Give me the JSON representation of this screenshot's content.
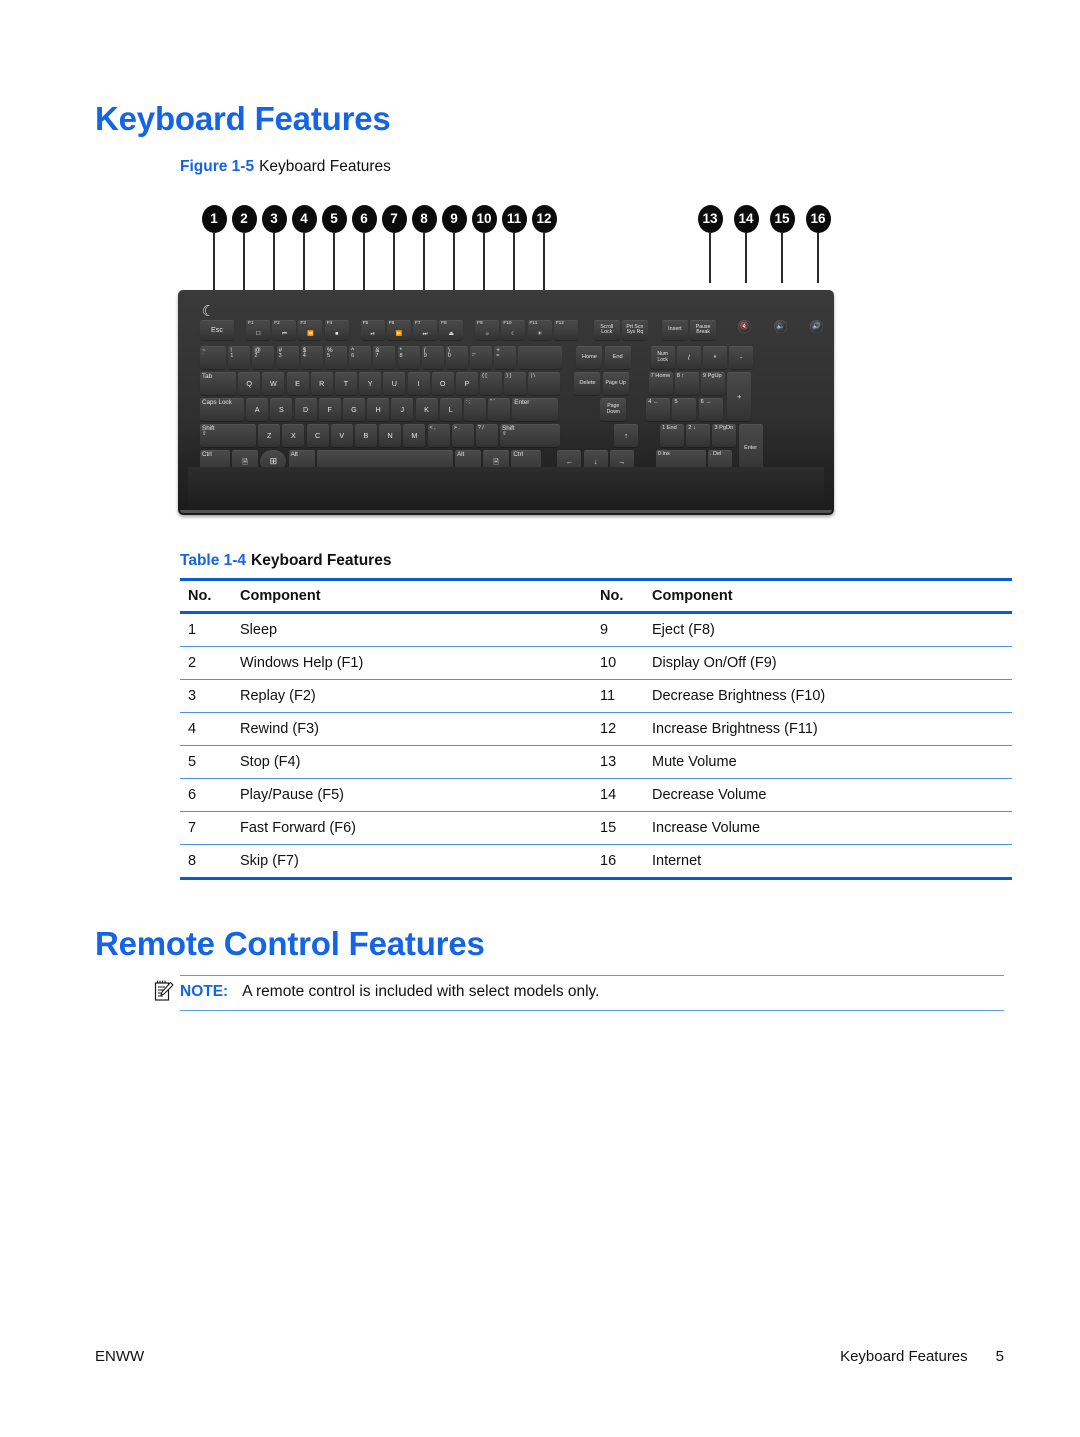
{
  "document": {
    "section_heading": "Keyboard Features",
    "figure": {
      "label": "Figure 1-5",
      "title": "Keyboard Features",
      "callouts": [
        "1",
        "2",
        "3",
        "4",
        "5",
        "6",
        "7",
        "8",
        "9",
        "10",
        "11",
        "12",
        "13",
        "14",
        "15",
        "16"
      ],
      "keyboard": {
        "indicator": "sleep-moon",
        "function_row": [
          "Esc",
          "F1",
          "F2",
          "F3",
          "F4",
          "F5",
          "F6",
          "F7",
          "F8",
          "F9",
          "F10",
          "F11",
          "F12",
          "Scroll Lock",
          "Prt Scn Sys Rq",
          "Insert",
          "Pause Break"
        ],
        "media_buttons": [
          "Mute Volume",
          "Decrease Volume",
          "Increase Volume",
          "Internet"
        ],
        "number_row": [
          {
            "a": "~",
            "b": "`"
          },
          {
            "a": "!",
            "b": "1"
          },
          {
            "a": "@",
            "b": "2"
          },
          {
            "a": "#",
            "b": "3"
          },
          {
            "a": "$",
            "b": "4"
          },
          {
            "a": "%",
            "b": "5"
          },
          {
            "a": "^",
            "b": "6"
          },
          {
            "a": "&",
            "b": "7"
          },
          {
            "a": "*",
            "b": "8"
          },
          {
            "a": "(",
            "b": "9"
          },
          {
            "a": ")",
            "b": "0"
          },
          {
            "a": "_",
            "b": "-"
          },
          {
            "a": "+",
            "b": "="
          },
          {
            "a": "",
            "b": "Backspace"
          }
        ],
        "tab_row": [
          "Tab",
          "Q",
          "W",
          "E",
          "R",
          "T",
          "Y",
          "U",
          "I",
          "O",
          "P",
          "{ [",
          "} ]",
          "| \\"
        ],
        "caps_row": [
          "Caps Lock",
          "A",
          "S",
          "D",
          "F",
          "G",
          "H",
          "J",
          "K",
          "L",
          ": ;",
          "\" '",
          "Enter"
        ],
        "shift_row": [
          "Shift",
          "Z",
          "X",
          "C",
          "V",
          "B",
          "N",
          "M",
          "< ,",
          "> .",
          "? /",
          "Shift"
        ],
        "ctrl_row": [
          "Ctrl",
          "menu-icon",
          "windows-icon",
          "Alt",
          "Space",
          "Alt",
          "menu-icon",
          "Ctrl"
        ],
        "nav_cluster": [
          "Home",
          "End",
          "Delete",
          "Page Up",
          "Page Down"
        ],
        "arrows": [
          "↑",
          "←",
          "↓",
          "→"
        ],
        "numpad": [
          "Num Lock",
          "/",
          "*",
          "-",
          "7 Home",
          "8 ↑",
          "9 PgUp",
          "+",
          "4 ←",
          "5",
          "6 →",
          "1 End",
          "2 ↓",
          "3 PgDn",
          "Enter",
          "0 Ins",
          ". Del"
        ]
      }
    },
    "table": {
      "label": "Table 1-4",
      "title": "Keyboard Features",
      "headers": [
        "No.",
        "Component",
        "No.",
        "Component"
      ],
      "rows": [
        {
          "no": "1",
          "component": "Sleep",
          "no2": "9",
          "component2": "Eject (F8)"
        },
        {
          "no": "2",
          "component": "Windows Help (F1)",
          "no2": "10",
          "component2": "Display On/Off (F9)"
        },
        {
          "no": "3",
          "component": "Replay (F2)",
          "no2": "11",
          "component2": "Decrease Brightness (F10)"
        },
        {
          "no": "4",
          "component": "Rewind (F3)",
          "no2": "12",
          "component2": "Increase Brightness (F11)"
        },
        {
          "no": "5",
          "component": "Stop (F4)",
          "no2": "13",
          "component2": "Mute Volume"
        },
        {
          "no": "6",
          "component": "Play/Pause (F5)",
          "no2": "14",
          "component2": "Decrease Volume"
        },
        {
          "no": "7",
          "component": "Fast Forward (F6)",
          "no2": "15",
          "component2": "Increase Volume"
        },
        {
          "no": "8",
          "component": "Skip (F7)",
          "no2": "16",
          "component2": "Internet"
        }
      ]
    },
    "remote_heading": "Remote Control Features",
    "note": {
      "icon": "note-pad-icon",
      "label": "NOTE:",
      "text": "A remote control is included with select models only."
    },
    "footer": {
      "left": "ENWW",
      "right": "Keyboard Features",
      "page": "5"
    },
    "colors": {
      "heading_blue": "#1464E6",
      "rule_blue": "#0a5ad4",
      "row_rule_blue": "#4a90e8",
      "body_text": "#111111",
      "keyboard_body": "#2f2f2f"
    }
  }
}
